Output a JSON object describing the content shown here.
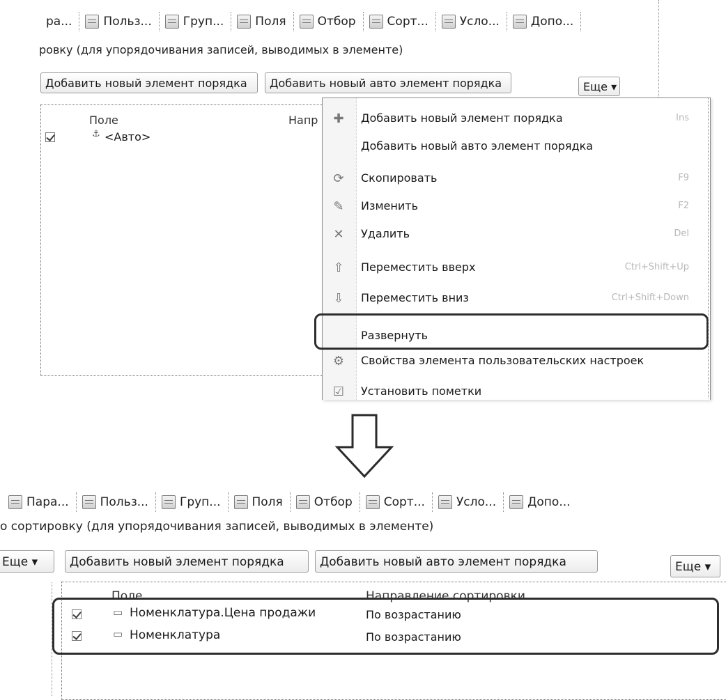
{
  "top": {
    "tabs": [
      {
        "label": "ра...",
        "icon": "params-icon"
      },
      {
        "label": "Польз...",
        "icon": "user-fields-icon"
      },
      {
        "label": "Груп...",
        "icon": "grouping-icon"
      },
      {
        "label": "Поля",
        "icon": "fields-icon"
      },
      {
        "label": "Отбор",
        "icon": "filter-icon"
      },
      {
        "label": "Сорт...",
        "icon": "sort-icon"
      },
      {
        "label": "Усло...",
        "icon": "conditional-icon"
      },
      {
        "label": "Допо...",
        "icon": "additional-icon"
      }
    ],
    "hint": "ровку (для упорядочивания записей, выводимых в элементе)",
    "buttons": {
      "add": "Добавить новый элемент порядка",
      "add_auto": "Добавить новый авто элемент порядка",
      "more": "Еще ▾"
    },
    "table": {
      "col_field": "Поле",
      "col_direction": "Напр",
      "rows": [
        {
          "field": "<Авто>",
          "checked": true
        }
      ]
    },
    "menu": {
      "items": [
        {
          "icon": "add-icon",
          "label": "Добавить новый элемент порядка",
          "shortcut": "Ins"
        },
        {
          "icon": "",
          "label": "Добавить новый авто элемент порядка",
          "shortcut": ""
        },
        {
          "icon": "copy-icon",
          "label": "Скопировать",
          "shortcut": "F9"
        },
        {
          "icon": "edit-icon",
          "label": "Изменить",
          "shortcut": "F2"
        },
        {
          "icon": "delete-icon",
          "label": "Удалить",
          "shortcut": "Del"
        },
        {
          "icon": "move-up-icon",
          "label": "Переместить вверх",
          "shortcut": "Ctrl+Shift+Up"
        },
        {
          "icon": "move-down-icon",
          "label": "Переместить вниз",
          "shortcut": "Ctrl+Shift+Down"
        },
        {
          "icon": "",
          "label": "Развернуть",
          "shortcut": ""
        },
        {
          "icon": "properties-icon",
          "label": "Свойства элемента пользовательских настроек",
          "shortcut": ""
        },
        {
          "icon": "checkmarks-icon",
          "label": "Установить пометки",
          "shortcut": ""
        }
      ]
    }
  },
  "bottom": {
    "tabs": [
      {
        "label": "Пара...",
        "icon": "params-icon"
      },
      {
        "label": "Польз...",
        "icon": "user-fields-icon"
      },
      {
        "label": "Груп...",
        "icon": "grouping-icon"
      },
      {
        "label": "Поля",
        "icon": "fields-icon"
      },
      {
        "label": "Отбор",
        "icon": "filter-icon"
      },
      {
        "label": "Сорт...",
        "icon": "sort-icon"
      },
      {
        "label": "Усло...",
        "icon": "conditional-icon"
      },
      {
        "label": "Допо...",
        "icon": "additional-icon"
      }
    ],
    "hint": "о сортировку (для упорядочивания записей, выводимых в элементе)",
    "buttons": {
      "left_more": "Еще ▾",
      "add": "Добавить новый элемент порядка",
      "add_auto": "Добавить новый авто элемент порядка",
      "more": "Еще ▾"
    },
    "table": {
      "col_field": "Поле",
      "col_direction": "Направление сортировки",
      "rows": [
        {
          "field": "Номенклатура.Цена продажи",
          "direction": "По возрастанию",
          "checked": true
        },
        {
          "field": "Номенклатура",
          "direction": "По возрастанию",
          "checked": true
        }
      ]
    }
  }
}
